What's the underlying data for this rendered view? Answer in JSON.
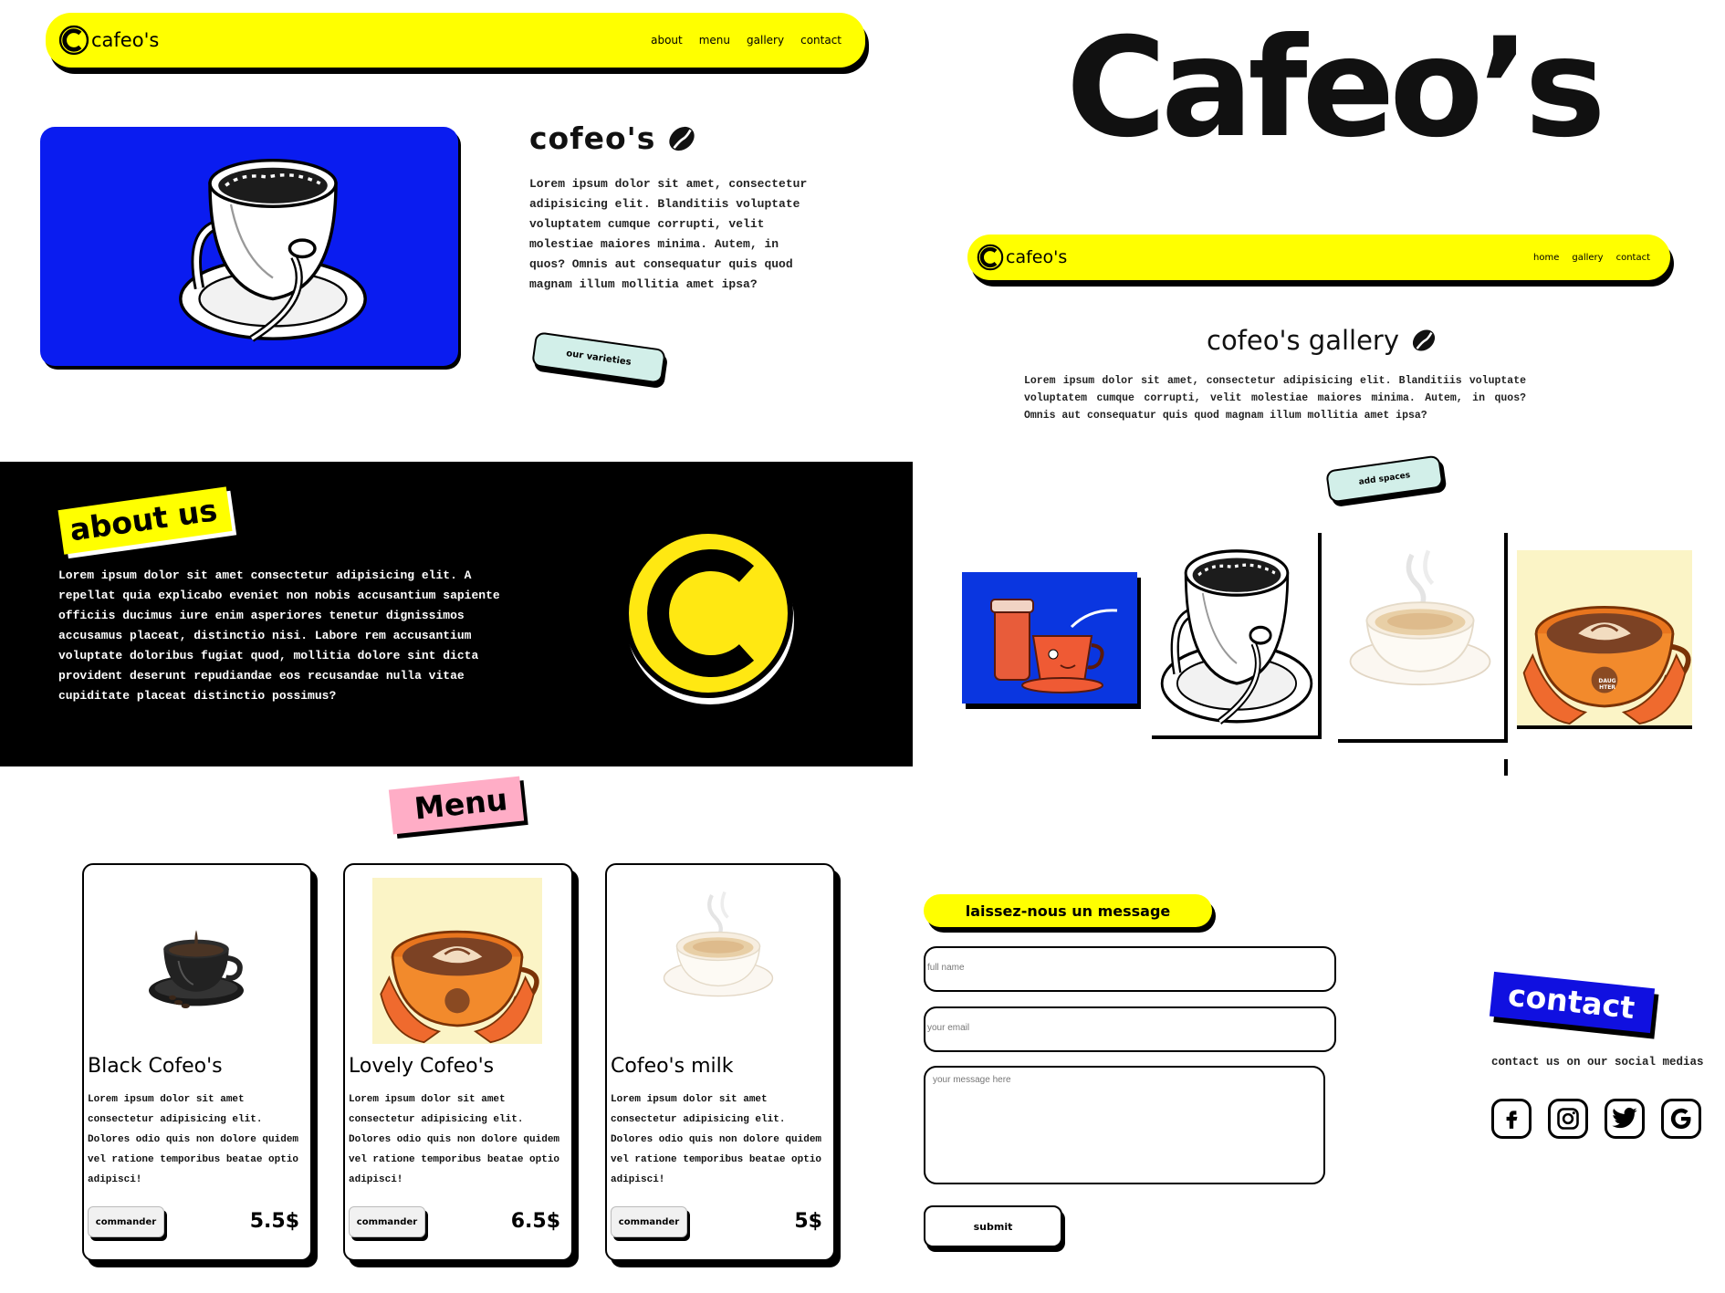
{
  "colors": {
    "accent_yellow": "#ffff00",
    "accent_blue": "#0a1cf0",
    "mint": "#d2efe9",
    "pink": "#ffadc6",
    "black": "#000000"
  },
  "brand": {
    "name": "cafeo's",
    "big_title": "Cafeo’s"
  },
  "page1": {
    "nav": {
      "items": [
        "about",
        "menu",
        "gallery",
        "contact"
      ]
    },
    "hero": {
      "title": "cofeo's",
      "body": "Lorem ipsum dolor sit amet, consectetur adipisicing elit. Blanditiis voluptate voluptatem cumque corrupti, velit molestiae maiores minima. Autem, in quos? Omnis aut consequatur quis quod magnam illum mollitia amet ipsa?",
      "button": "our varieties"
    },
    "about": {
      "label": "about us",
      "body": "Lorem ipsum dolor sit amet consectetur adipisicing elit. A repellat quia explicabo eveniet non nobis accusantium sapiente officiis ducimus iure enim asperiores tenetur dignissimos accusamus placeat, distinctio nisi. Labore rem accusantium voluptate doloribus fugiat quod, mollitia dolore sint dicta provident deserunt repudiandae eos recusandae nulla vitae cupiditate placeat distinctio possimus?"
    },
    "menu": {
      "label": "Menu",
      "cards": [
        {
          "title": "Black Cofeo's",
          "desc": "Lorem ipsum dolor sit amet consectetur adipisicing elit. Dolores odio quis non dolore quidem vel ratione temporibus beatae optio adipisci!",
          "button": "commander",
          "price": "5.5$"
        },
        {
          "title": "Lovely Cofeo's",
          "desc": "Lorem ipsum dolor sit amet consectetur adipisicing elit. Dolores odio quis non dolore quidem vel ratione temporibus beatae optio adipisci!",
          "button": "commander",
          "price": "6.5$"
        },
        {
          "title": "Cofeo's milk",
          "desc": "Lorem ipsum dolor sit amet consectetur adipisicing elit. Dolores odio quis non dolore quidem vel ratione temporibus beatae optio adipisci!",
          "button": "commander",
          "price": "5$"
        }
      ]
    }
  },
  "page2": {
    "nav": {
      "items": [
        "home",
        "gallery",
        "contact"
      ]
    },
    "gallery": {
      "title": "cofeo's gallery",
      "body": "Lorem ipsum dolor sit amet, consectetur adipisicing elit. Blanditiis voluptate voluptatem cumque corrupti, velit molestiae maiores minima. Autem, in quos? Omnis aut consequatur quis quod magnam illum mollitia amet ipsa?",
      "button": "add spaces",
      "mug_text": "DAUG HTER"
    },
    "contact": {
      "message_label": "laissez-nous un message",
      "fullname_placeholder": "full name",
      "email_placeholder": "your email",
      "message_placeholder": "your message here",
      "submit": "submit",
      "label": "contact",
      "social_text": "contact us on our social medias",
      "socials": [
        "facebook",
        "instagram",
        "twitter",
        "google"
      ]
    }
  }
}
